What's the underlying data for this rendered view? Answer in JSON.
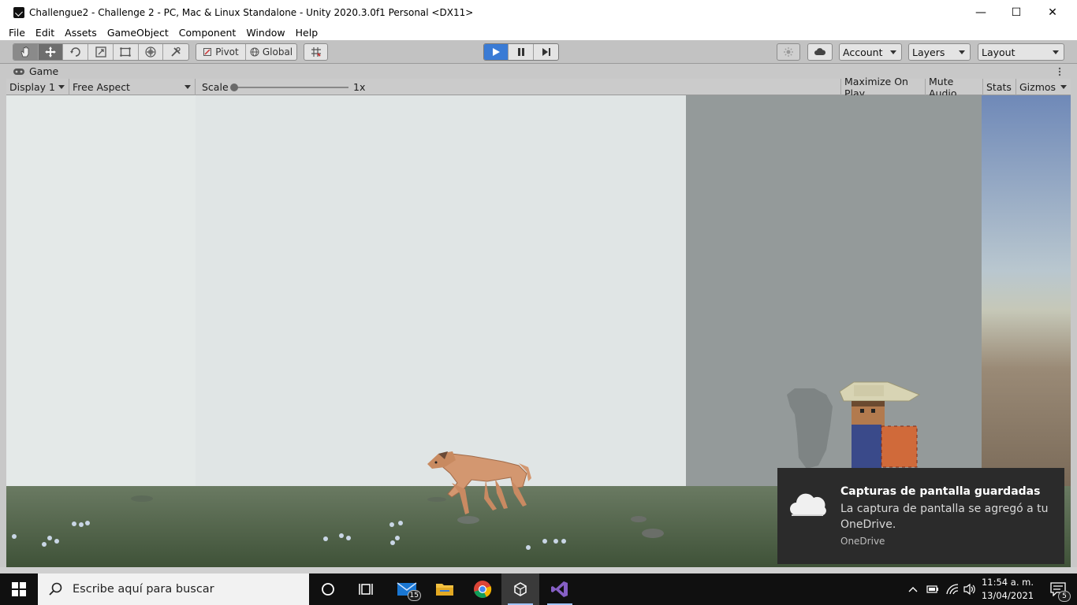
{
  "window": {
    "title": "Challengue2 - Challenge 2 - PC, Mac & Linux Standalone - Unity 2020.3.0f1 Personal <DX11>",
    "minimize_glyph": "—",
    "maximize_glyph": "☐",
    "close_glyph": "✕"
  },
  "menu": {
    "items": [
      "File",
      "Edit",
      "Assets",
      "GameObject",
      "Component",
      "Window",
      "Help"
    ]
  },
  "toolbar": {
    "pivot_label": "Pivot",
    "global_label": "Global",
    "account_label": "Account",
    "layers_label": "Layers",
    "layout_label": "Layout"
  },
  "game": {
    "tab_label": "Game",
    "display_label": "Display 1",
    "aspect_label": "Free Aspect",
    "scale_label": "Scale",
    "scale_value": "1x",
    "scale_fraction": 0.0,
    "maximize_label": "Maximize On Play",
    "mute_label": "Mute Audio",
    "stats_label": "Stats",
    "gizmos_label": "Gizmos"
  },
  "notification": {
    "title": "Capturas de pantalla guardadas",
    "body": "La captura de pantalla se agregó a tu OneDrive.",
    "source": "OneDrive"
  },
  "taskbar": {
    "search_placeholder": "Escribe aquí para buscar",
    "mail_badge": "15",
    "time": "11:54 a. m.",
    "date": "13/04/2021",
    "notifications_badge": "5"
  },
  "colors": {
    "accent": "#3a7bd5",
    "toolbar_bg": "#c2c2c2",
    "sky": "#dde3e3",
    "ground": "#4e5e46",
    "toast_bg": "#2b2b2b",
    "taskbar_bg": "#101010"
  }
}
